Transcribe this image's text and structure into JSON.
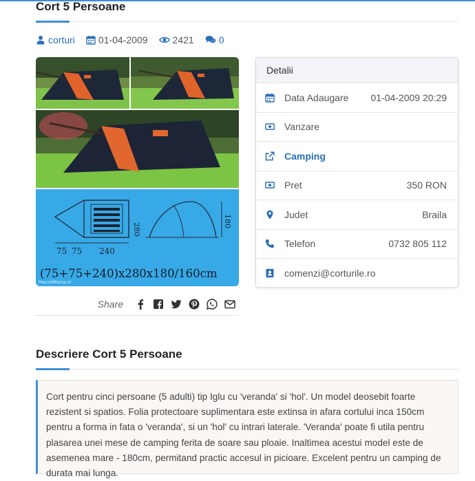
{
  "post": {
    "title": "Cort 5 Persoane",
    "category": "corturi",
    "date": "01-04-2009",
    "views": "2421",
    "comments": "0"
  },
  "share": {
    "label": "Share",
    "icons": [
      "facebook-icon",
      "facebook-square-icon",
      "twitter-icon",
      "pinterest-icon",
      "whatsapp-icon",
      "email-icon"
    ]
  },
  "details": {
    "header": "Detalii",
    "rows": [
      {
        "icon": "calendar-icon",
        "label": "Data Adaugare",
        "value": "01-04-2009 20:29"
      },
      {
        "icon": "money-icon",
        "label": "Vanzare",
        "value": ""
      },
      {
        "icon": "external-link-icon",
        "label": "Camping",
        "value": ""
      },
      {
        "icon": "money-icon",
        "label": "Pret",
        "value": "350 RON"
      },
      {
        "icon": "map-marker-icon",
        "label": "Judet",
        "value": "Braila"
      },
      {
        "icon": "phone-icon",
        "label": "Telefon",
        "value": "0732 805 112"
      },
      {
        "icon": "address-book-icon",
        "label": "comenzi@corturile.ro",
        "value": ""
      }
    ]
  },
  "image": {
    "dimension_caption": "(75+75+240)x280x180/160cm",
    "watermark": "PescuitMania.ro",
    "dims": {
      "w1": "75",
      "w2": "75",
      "w3": "240",
      "depth": "280",
      "height": "180"
    }
  },
  "description": {
    "title": "Descriere Cort 5 Persoane",
    "text": "Cort pentru cinci persoane (5 adulti) tip Iglu cu 'veranda' si 'hol'. Un model deosebit foarte rezistent si spatios. Folia protectoare suplimentara este extinsa in afara cortului inca 150cm pentru a forma in fata o 'veranda', si un 'hol' cu intrari laterale. 'Veranda' poate fi utila pentru plasarea unei mese de camping ferita de soare sau ploaie. Inaltimea acestui model este de asemenea mare - 180cm, permitand practic accesul in picioare. Excelent pentru un camping de durata mai lunga."
  },
  "colors": {
    "accent": "#3d8fd6",
    "link": "#2a6fb8"
  }
}
